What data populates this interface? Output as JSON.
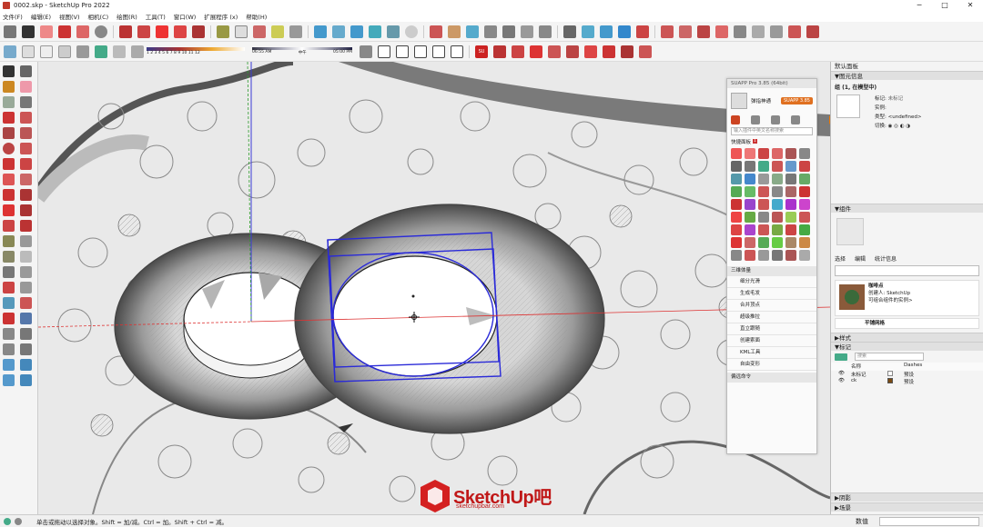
{
  "window": {
    "title": "0002.skp - SketchUp Pro 2022",
    "controls": [
      "─",
      "□",
      "✕"
    ]
  },
  "menu": [
    "文件(F)",
    "编辑(E)",
    "视图(V)",
    "相机(C)",
    "绘图(R)",
    "工具(T)",
    "窗口(W)",
    "扩展程序 (x)",
    "帮助(H)"
  ],
  "shadow": {
    "months": "1 2 3 4 5 6 7 8 9 10 11 12",
    "time_start": "06:55 AM",
    "time_mid": "中午",
    "time_end": "05:00 PM"
  },
  "plugin": {
    "title": "SUAPP Pro 3.85 (64bit)",
    "badge": "SUAPP 3.85",
    "user": "弹指神通",
    "search_placeholder": "输入插件中英文名称搜索",
    "quick_label": "快捷面板",
    "section": "三维体量",
    "items": [
      "细分光滑",
      "生成毛发",
      "合并顶点",
      "超级推拉",
      "直立跟随",
      "创建索面",
      "KML工具",
      "自由变形"
    ],
    "footer": "偏远命令"
  },
  "tray": {
    "title": "默认面板",
    "entity_info": {
      "header": "图元信息",
      "name": "组 (1, 在模型中)",
      "tag_label": "标记:",
      "tag_value": "未标记",
      "instance_label": "实例:",
      "type_label": "类型:",
      "type_value": "<undefined>",
      "toggle_label": "切换:"
    },
    "components": {
      "header": "组件",
      "tabs": [
        "选择",
        "编辑",
        "统计信息"
      ],
      "item1_name": "咖啡点",
      "item1_desc1": "创建人: SketchUp",
      "item1_desc2": "可组合组件的实例>",
      "item2_name": "平铺网格"
    },
    "styles_header": "样式",
    "tags": {
      "header": "标记",
      "search_placeholder": "搜索",
      "col_name": "名称",
      "col_dashes": "Dashes",
      "rows": [
        {
          "name": "未标记",
          "dash": "预设",
          "color": "#ffffff"
        },
        {
          "name": "ck",
          "dash": "预设",
          "color": "#7a4a12"
        }
      ]
    },
    "shadows_header": "阴影",
    "scenes_header": "场景"
  },
  "status": {
    "hint": "单击或拖动以选择对象。Shift = 加/减。Ctrl = 加。Shift + Ctrl = 减。",
    "measure_label": "数值"
  },
  "watermark": {
    "brand": "SketchUp",
    "brand_suffix": "吧",
    "url": "sketchupbar.com"
  }
}
